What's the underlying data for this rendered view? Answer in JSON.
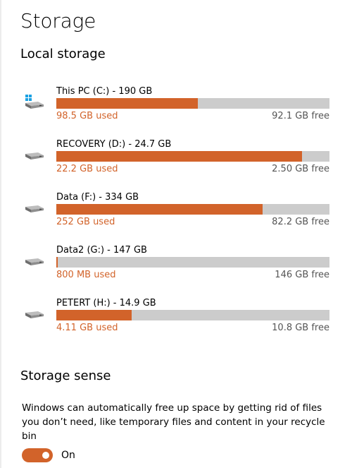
{
  "page": {
    "title": "Storage"
  },
  "local_storage": {
    "title": "Local storage",
    "drives": [
      {
        "name": "This PC (C:) - 190 GB",
        "used": "98.5 GB used",
        "free": "92.1 GB free",
        "used_fraction": 0.5184,
        "icon": "windows-system-drive-icon"
      },
      {
        "name": "RECOVERY (D:) - 24.7 GB",
        "used": "22.2 GB used",
        "free": "2.50 GB free",
        "used_fraction": 0.8988,
        "icon": "drive-icon"
      },
      {
        "name": "Data (F:) - 334 GB",
        "used": "252 GB used",
        "free": "82.2 GB free",
        "used_fraction": 0.7545,
        "icon": "drive-icon"
      },
      {
        "name": "Data2 (G:) - 147 GB",
        "used": "800 MB used",
        "free": "146 GB free",
        "used_fraction": 0.0054,
        "icon": "drive-icon"
      },
      {
        "name": "PETERT (H:) - 14.9 GB",
        "used": "4.11 GB used",
        "free": "10.8 GB free",
        "used_fraction": 0.2758,
        "icon": "drive-icon"
      }
    ]
  },
  "storage_sense": {
    "title": "Storage sense",
    "description": "Windows can automatically free up space by getting rid of files you don’t need, like temporary files and content in your recycle bin",
    "toggle": {
      "state": "on",
      "label": "On"
    }
  },
  "colors": {
    "accent": "#d2632a",
    "bar_track": "#cccccc",
    "free_text": "#555555"
  }
}
